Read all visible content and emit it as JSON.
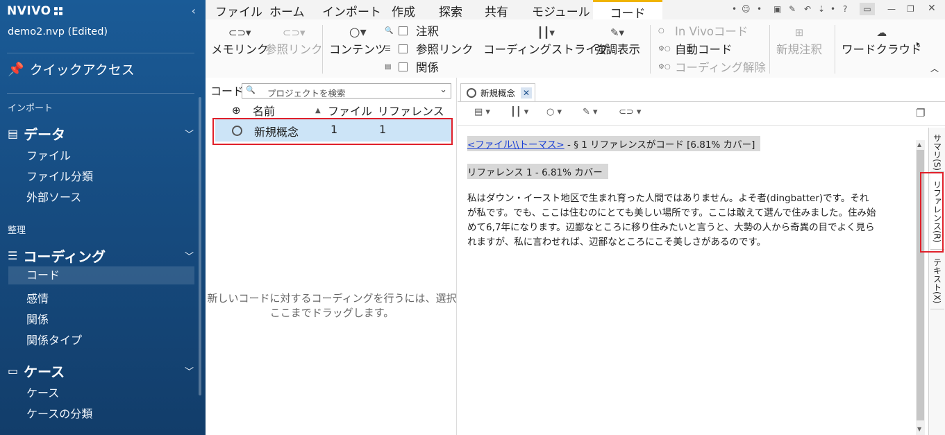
{
  "sidebar": {
    "app_name": "NVIVO",
    "project": "demo2.nvp (Edited)",
    "quick_access": "クイックアクセス",
    "sections": [
      {
        "label": "インポート"
      },
      {
        "label": "整理"
      }
    ],
    "groups": {
      "data": {
        "label": "データ",
        "items": [
          "ファイル",
          "ファイル分類",
          "外部ソース"
        ]
      },
      "coding": {
        "label": "コーディング",
        "items": [
          "コード",
          "感情",
          "関係",
          "関係タイプ"
        ]
      },
      "cases": {
        "label": "ケース",
        "items": [
          "ケース",
          "ケースの分類"
        ]
      }
    }
  },
  "ribbon": {
    "tabs": [
      "ファイル",
      "ホーム",
      "インポート",
      "作成",
      "探索",
      "共有",
      "モジュール",
      "コード"
    ],
    "active_tab": "コード",
    "buttons": {
      "memo_link": "メモリンク",
      "see_also_link": "参照リンク",
      "contents": "コンテンツ",
      "annotation": "注釈",
      "see_also": "参照リンク",
      "relations": "関係",
      "coding_stripes": "コーディングストライプ",
      "highlight": "強調表示",
      "in_vivo": "In Vivoコード",
      "auto_code": "自動コード",
      "uncode": "コーディング解除",
      "new_annotation": "新規注釈",
      "word_cloud": "ワードクラウド"
    }
  },
  "codes_panel": {
    "title": "コード",
    "search_placeholder": "プロジェクトを検索",
    "columns": {
      "name": "名前",
      "files": "ファイル",
      "references": "リファレンス"
    },
    "rows": [
      {
        "name": "新規概念",
        "files": "1",
        "references": "1"
      }
    ],
    "hint_line1": "新しいコードに対するコーディングを行うには、選択",
    "hint_line2": "ここまでドラッグします。"
  },
  "detail": {
    "tab_label": "新規概念",
    "header_link": "<ファイル\\\\トーマス>",
    "header_rest": " - § 1 リファレンスがコード [6.81% カバー]",
    "reference_label": "リファレンス 1 - 6.81% カバー",
    "paragraph": "私はダウン・イースト地区で生まれ育った人間ではありません。よそ者(dingbatter)です。それが私です。でも、ここは住むのにとても美しい場所です。ここは敢えて選んで住みました。住み始めて6,7年になります。辺鄙なところに移り住みたいと言うと、大勢の人から奇異の目でよく見られますが、私に言わせれば、辺鄙なところにこそ美しさがあるのです。",
    "side_tabs": [
      "サマリ(S)",
      "リファレンス(R)",
      "テキスト(X)"
    ]
  }
}
